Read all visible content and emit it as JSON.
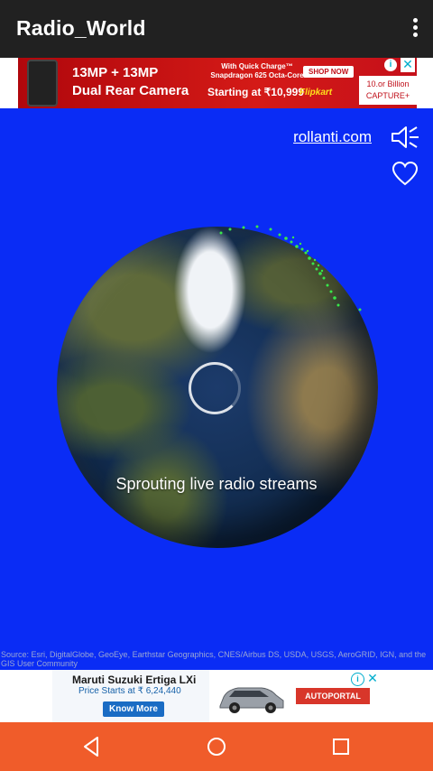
{
  "app": {
    "title": "Radio_World",
    "menu_icon": "more-vert-icon"
  },
  "top_ad": {
    "headline1": "13MP + 13MP",
    "headline2": "Dual Rear Camera",
    "small_text": "With Quick Charge™ Snapdragon 625 Octa-Core",
    "offer": "Starting at ₹10,999",
    "shop_button": "SHOP NOW",
    "store": "Flipkart",
    "brand": "10.or Billion CAPTURE+",
    "adchoices_icon": "adchoices-icon",
    "close_icon": "close-icon"
  },
  "main": {
    "site_link": "rollanti.com",
    "mute_icon": "speaker-mute-icon",
    "favorite_icon": "heart-outline-icon",
    "status": "Sprouting live radio streams",
    "credit": "Source: Esri, DigitalGlobe, GeoEye, Earthstar Geographics, CNES/Airbus DS, USDA, USGS, AeroGRID, IGN, and the GIS User Community",
    "background_color": "#0a2cf5"
  },
  "bottom_ad": {
    "title": "Maruti Suzuki Ertiga LXi",
    "price": "Price Starts at ₹ 6,24,440",
    "cta": "Know More",
    "partner": "AUTOPORTAL",
    "adchoices_icon": "adchoices-icon",
    "close_icon": "close-icon"
  },
  "navigation": {
    "back_icon": "back-triangle-icon",
    "home_icon": "home-circle-icon",
    "recents_icon": "recents-square-icon",
    "bar_color": "#f05c2a"
  }
}
